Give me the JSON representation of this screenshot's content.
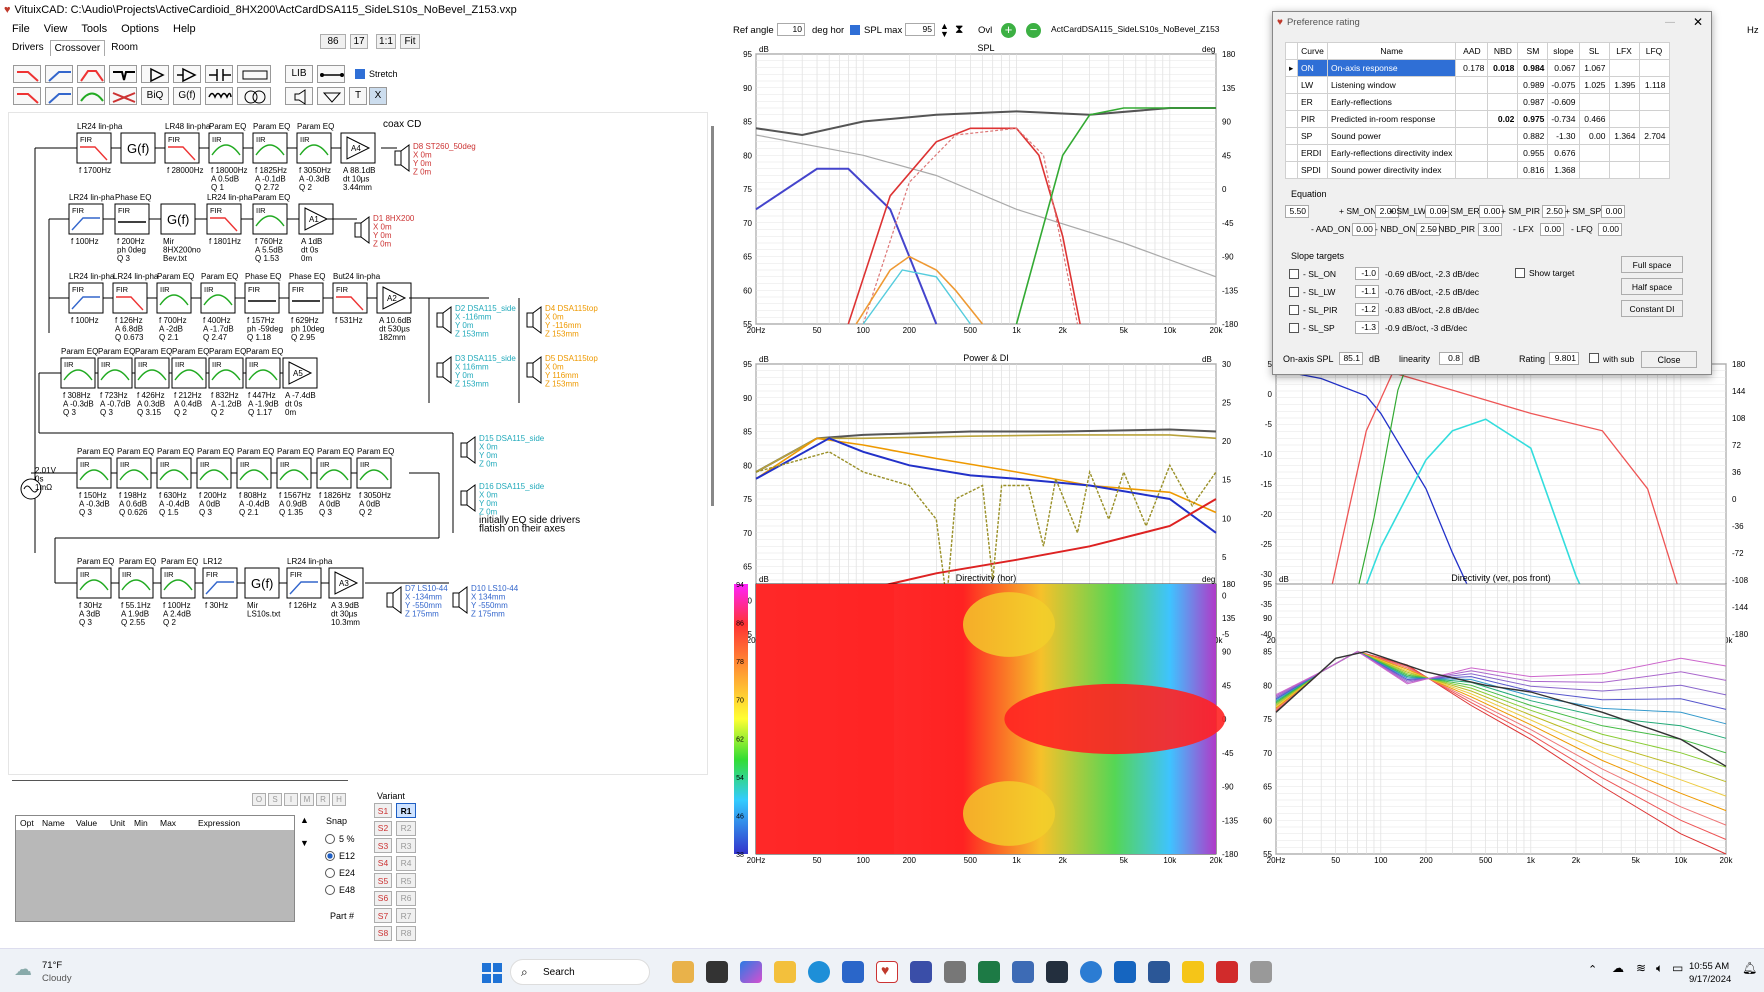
{
  "title": "VituixCAD: C:\\Audio\\Projects\\ActiveCardioid_8HX200\\ActCardDSA115_SideLS10s_NoBevel_Z153.vxp",
  "menu": [
    "File",
    "View",
    "Tools",
    "Options",
    "Help"
  ],
  "tabs": [
    "Drivers",
    "Crossover",
    "Room"
  ],
  "toolbar_fields": {
    "f1": "86",
    "f2": "17",
    "f3": "1:1",
    "f4": "Fit",
    "stretch": "Stretch",
    "lib": "LIB",
    "biq": "BiQ",
    "gf": "G(f)",
    "t": "T",
    "x": "X"
  },
  "top_controls": {
    "ref_angle_label": "Ref angle",
    "ref_angle": "10",
    "deg_hor": "deg hor",
    "spl_max_label": "SPL max",
    "spl_max": "95",
    "ovl": "Ovl",
    "overlay_file": "ActCardDSA115_SideLS10s_NoBevel_Z153",
    "hz": "Hz"
  },
  "schematic": {
    "row1": {
      "titles": [
        "LR24 lin-pha",
        "",
        "LR48 lin-pha",
        "Param EQ",
        "Param EQ",
        "Param EQ",
        ""
      ],
      "types": [
        "FIR",
        "G(f)",
        "FIR",
        "IIR",
        "IIR",
        "IIR",
        "A4"
      ],
      "params": [
        "f 1700Hz",
        "",
        "f 28000Hz",
        "f 18000Hz\nA 0.5dB\nQ 1",
        "f 1825Hz\nA -0.1dB\nQ 2.72",
        "f 3050Hz\nA -0.3dB\nQ 2",
        "A 88.1dB\ndt 10µs\n3.44mm"
      ],
      "note": "coax CD",
      "driver": "D8 ST260_50deg\nX 0m\nY 0m\nZ 0m"
    },
    "row2": {
      "titles": [
        "LR24 lin-pha",
        "Phase EQ",
        "",
        "LR24 lin-pha",
        "Param EQ",
        ""
      ],
      "types": [
        "FIR",
        "FIR",
        "G(f)",
        "FIR",
        "IIR",
        "A1"
      ],
      "params": [
        "f 100Hz",
        "f 200Hz\nph 0deg\nQ 3",
        "Mir\n8HX200no\nBev.txt",
        "f 1801Hz",
        "f 760Hz\nA 5.5dB\nQ 1.53",
        "A 1dB\ndt 0s\n0m"
      ],
      "driver": "D1 8HX200\nX 0m\nY 0m\nZ 0m"
    },
    "row3": {
      "titles": [
        "LR24 lin-pha",
        "LR24 lin-pha",
        "Param EQ",
        "Param EQ",
        "Phase EQ",
        "Phase EQ",
        "But24 lin-pha",
        ""
      ],
      "types": [
        "FIR",
        "FIR",
        "IIR",
        "IIR",
        "FIR",
        "FIR",
        "FIR",
        "A2"
      ],
      "params": [
        "f 100Hz",
        "f 126Hz\nA 6.8dB\nQ 0.673",
        "f 700Hz\nA -2dB\nQ 2.1",
        "f 400Hz\nA -1.7dB\nQ 2.47",
        "f 157Hz\nph -59deg\nQ 1.18",
        "f 629Hz\nph 10deg\nQ 2.95",
        "f 531Hz",
        "A 10.6dB\ndt 530µs\n182mm"
      ],
      "drivers": [
        "D2 DSA115_side\nX -116mm\nY 0m\nZ 153mm",
        "D3 DSA115_side\nX 116mm\nY 0m\nZ 153mm",
        "D4 DSA115top\nX 0m\nY -116mm\nZ 153mm",
        "D5 DSA115top\nX 0m\nY 116mm\nZ 153mm"
      ]
    },
    "row4": {
      "titles": [
        "Param EQ",
        "Param EQ",
        "Param EQ",
        "Param EQ",
        "Param EQ",
        "Param EQ",
        ""
      ],
      "types": [
        "IIR",
        "IIR",
        "IIR",
        "IIR",
        "IIR",
        "IIR",
        "A5"
      ],
      "params": [
        "f 308Hz\nA -0.3dB\nQ 3",
        "f 723Hz\nA -0.7dB\nQ 3",
        "f 426Hz\nA 0.3dB\nQ 3.15",
        "f 212Hz\nA 0.4dB\nQ 2",
        "f 832Hz\nA -1.2dB\nQ 2",
        "f 447Hz\nA -1.9dB\nQ 1.17",
        "A -7.4dB\ndt 0s\n0m"
      ],
      "drivers": [
        "D15 DSA115_side\nX 0m\nY 0m\nZ 0m",
        "D16 DSA115_side\nX 0m\nY 0m\nZ 0m"
      ]
    },
    "row5": {
      "titles": [
        "Param EQ",
        "Param EQ",
        "Param EQ",
        "Param EQ",
        "Param EQ",
        "Param EQ",
        "Param EQ",
        "Param EQ"
      ],
      "types": [
        "IIR",
        "IIR",
        "IIR",
        "IIR",
        "IIR",
        "IIR",
        "IIR",
        "IIR"
      ],
      "params": [
        "f 150Hz\nA -0.3dB\nQ 3",
        "f 198Hz\nA 0.6dB\nQ 0.626",
        "f 630Hz\nA -0.4dB\nQ 1.5",
        "f 200Hz\nA 0dB\nQ 3",
        "f 808Hz\nA -0.4dB\nQ 2.1",
        "f 1567Hz\nA 0.9dB\nQ 1.35",
        "f 1826Hz\nA 0dB\nQ 3",
        "f 3050Hz\nA 0dB\nQ 2"
      ],
      "source": "2.01V\n0s\n1mΩ",
      "note": "initially EQ side drivers\nflatish on their axes"
    },
    "row6": {
      "titles": [
        "Param EQ",
        "Param EQ",
        "Param EQ",
        "LR12",
        "",
        "LR24 lin-pha",
        ""
      ],
      "types": [
        "IIR",
        "IIR",
        "IIR",
        "FIR",
        "G(f)",
        "FIR",
        "A3"
      ],
      "params": [
        "f 30Hz\nA 3dB\nQ 3",
        "f 55.1Hz\nA 1.9dB\nQ 2.55",
        "f 100Hz\nA 2.4dB\nQ 2",
        "f 30Hz",
        "Mir\nLS10s.txt",
        "f 126Hz",
        "A 3.9dB\ndt 30µs\n10.3mm"
      ],
      "drivers": [
        "D7 LS10-44\nX -134mm\nY -550mm\nZ 175mm",
        "D10 LS10-44\nX 134mm\nY -550mm\nZ 175mm"
      ]
    }
  },
  "params_table": {
    "headers": [
      "Opt",
      "Name",
      "Value",
      "Unit",
      "Min",
      "Max",
      "Expression"
    ]
  },
  "snap": {
    "label": "Snap",
    "options": [
      "5 %",
      "E12",
      "E24",
      "E48"
    ],
    "selected": "E12",
    "part_label": "Part #"
  },
  "variant": {
    "label": "Variant",
    "s": [
      "S1",
      "S2",
      "S3",
      "S4",
      "S5",
      "S6",
      "S7",
      "S8"
    ],
    "r": [
      "R1",
      "R2",
      "R3",
      "R4",
      "R5",
      "R6",
      "R7",
      "R8"
    ],
    "active": "R1"
  },
  "mini_buttons": [
    "O",
    "S",
    "I",
    "M",
    "R",
    "H"
  ],
  "charts": {
    "spl": {
      "title": "SPL",
      "y_unit": "dB",
      "y2_unit": "deg",
      "yticks": [
        "95",
        "90",
        "85",
        "80",
        "75",
        "70",
        "65",
        "60",
        "55"
      ],
      "y2ticks": [
        "180",
        "135",
        "90",
        "45",
        "0",
        "-45",
        "-90",
        "-135",
        "-180"
      ]
    },
    "power": {
      "title": "Power & DI",
      "y_unit": "dB",
      "y2_unit": "dB",
      "yticks": [
        "95",
        "90",
        "85",
        "80",
        "75",
        "70",
        "65",
        "60",
        "55"
      ],
      "y2ticks": [
        "30",
        "25",
        "20",
        "15",
        "10",
        "5",
        "0",
        "-5"
      ]
    },
    "dirhor": {
      "title": "Directivity (hor)",
      "y_unit": "dB",
      "y2_unit": "deg",
      "colorbar": [
        "94",
        "86",
        "78",
        "70",
        "62",
        "54",
        "46",
        "38"
      ],
      "y2ticks": [
        "180",
        "135",
        "90",
        "45",
        "0",
        "-45",
        "-90",
        "-135",
        "-180"
      ]
    },
    "impulse": {
      "title": "",
      "yticks": [
        "5",
        "0",
        "-5",
        "-10",
        "-15",
        "-20",
        "-25",
        "-30",
        "-35",
        "-40"
      ],
      "y2ticks": [
        "180",
        "144",
        "108",
        "72",
        "36",
        "0",
        "-36",
        "-72",
        "-108",
        "-144",
        "-180"
      ]
    },
    "dirver": {
      "title": "Directivity (ver, pos front)",
      "y_unit": "dB",
      "yticks": [
        "95",
        "90",
        "85",
        "80",
        "75",
        "70",
        "65",
        "60",
        "55"
      ]
    },
    "xticks": [
      "20Hz",
      "50",
      "100",
      "200",
      "500",
      "1k",
      "2k",
      "5k",
      "10k",
      "20k"
    ]
  },
  "pref": {
    "title": "Preference rating",
    "headers": [
      "",
      "Curve",
      "Name",
      "AAD",
      "NBD",
      "SM",
      "slope",
      "SL",
      "LFX",
      "LFQ"
    ],
    "rows": [
      [
        "▸",
        "ON",
        "On-axis response",
        "0.178",
        "0.018",
        "0.984",
        "0.067",
        "1.067",
        "",
        ""
      ],
      [
        "",
        "LW",
        "Listening window",
        "",
        "",
        "0.989",
        "-0.075",
        "1.025",
        "1.395",
        "1.118"
      ],
      [
        "",
        "ER",
        "Early-reflections",
        "",
        "",
        "0.987",
        "-0.609",
        "",
        "",
        ""
      ],
      [
        "",
        "PIR",
        "Predicted in-room response",
        "",
        "0.02",
        "0.975",
        "-0.734",
        "0.466",
        "",
        ""
      ],
      [
        "",
        "SP",
        "Sound power",
        "",
        "",
        "0.882",
        "-1.30",
        "0.00",
        "1.364",
        "2.704"
      ],
      [
        "",
        "ERDI",
        "Early-reflections directivity index",
        "",
        "",
        "0.955",
        "0.676",
        "",
        "",
        ""
      ],
      [
        "",
        "SPDI",
        "Sound power directivity index",
        "",
        "",
        "0.816",
        "1.368",
        "",
        "",
        ""
      ]
    ],
    "equation_label": "Equation",
    "eq1": [
      [
        "",
        "5.50"
      ],
      [
        "+ SM_ON",
        "2.00"
      ],
      [
        "+ SM_LW",
        "0.00"
      ],
      [
        "+ SM_ER",
        "0.00"
      ],
      [
        "+ SM_PIR",
        "2.50"
      ],
      [
        "+ SM_SP",
        "0.00"
      ]
    ],
    "eq2": [
      [
        "- AAD_ON",
        "0.00"
      ],
      [
        "- NBD_ON",
        "2.50"
      ],
      [
        "- NBD_PIR",
        "3.00"
      ],
      [
        "- LFX",
        "0.00"
      ],
      [
        "- LFQ",
        "0.00"
      ]
    ],
    "slope_label": "Slope targets",
    "slopes": [
      [
        "- SL_ON",
        "-1.0",
        "-0.69 dB/oct, -2.3 dB/dec"
      ],
      [
        "- SL_LW",
        "-1.1",
        "-0.76 dB/oct, -2.5 dB/dec"
      ],
      [
        "- SL_PIR",
        "-1.2",
        "-0.83 dB/oct, -2.8 dB/dec"
      ],
      [
        "- SL_SP",
        "-1.3",
        "-0.9 dB/oct, -3 dB/dec"
      ]
    ],
    "show_target": "Show target",
    "buttons": [
      "Full space",
      "Half space",
      "Constant DI"
    ],
    "onaxis_label": "On-axis SPL",
    "onaxis": "85.1",
    "db": "dB",
    "lin_label": "linearity",
    "lin": "0.8",
    "rating_label": "Rating",
    "rating": "9.801",
    "with_sub": "with sub",
    "close": "Close"
  },
  "taskbar": {
    "weather_temp": "71°F",
    "weather": "Cloudy",
    "search": "Search",
    "time": "10:55 AM",
    "date": "9/17/2024"
  }
}
